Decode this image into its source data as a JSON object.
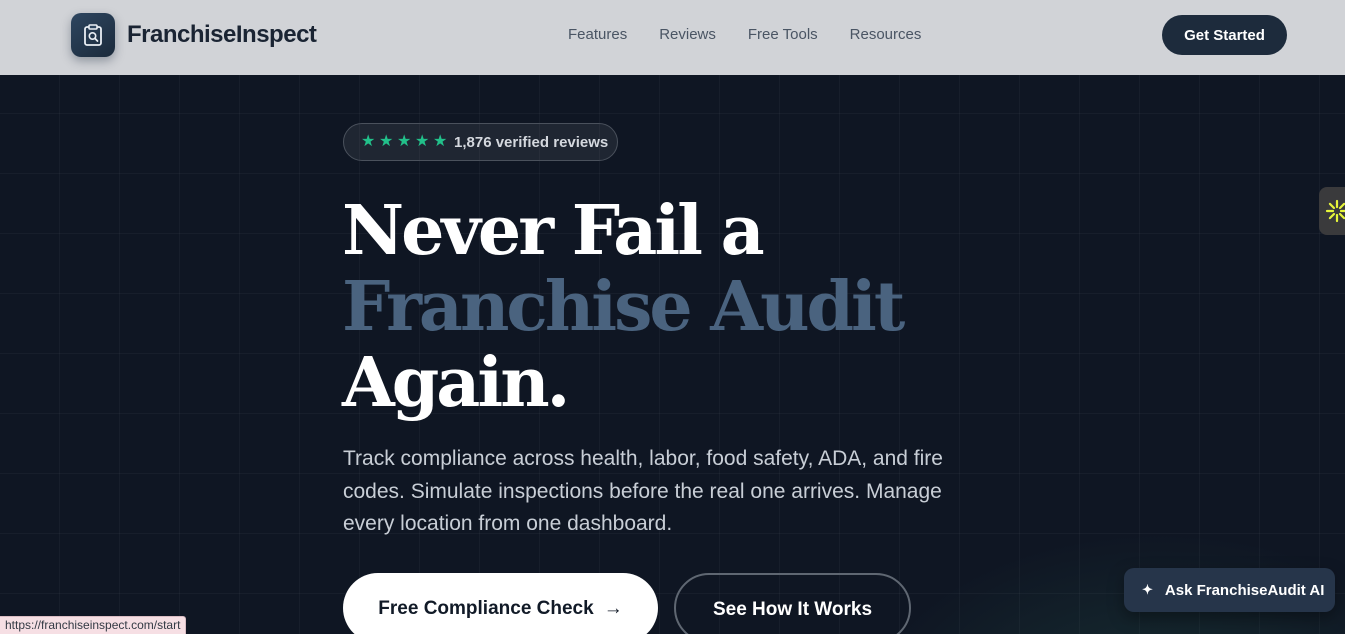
{
  "header": {
    "brand": "FranchiseInspect",
    "nav": [
      "Features",
      "Reviews",
      "Free Tools",
      "Resources"
    ],
    "cta": "Get Started"
  },
  "hero": {
    "rating_stars": 5,
    "reviews_label": "1,876 verified reviews",
    "headline_line1": "Never Fail a",
    "headline_line2": "Franchise Audit",
    "headline_line3": "Again.",
    "subcopy": "Track compliance across health, labor, food safety, ADA, and fire codes. Simulate inspections before the real one arrives. Manage every location from one dashboard.",
    "primary_cta": "Free Compliance Check",
    "primary_cta_arrow": "→",
    "secondary_cta": "See How It Works"
  },
  "assistant": {
    "label": "Ask FranchiseAudit AI",
    "icon": "sparkle-icon"
  },
  "status_bar": {
    "url": "https://franchiseinspect.com/start"
  },
  "colors": {
    "header_bg": "#d1d3d7",
    "hero_bg": "#0f1623",
    "star": "#22c08a",
    "headline_accent": "#4a637f",
    "primary_button": "#1d2b3c"
  }
}
